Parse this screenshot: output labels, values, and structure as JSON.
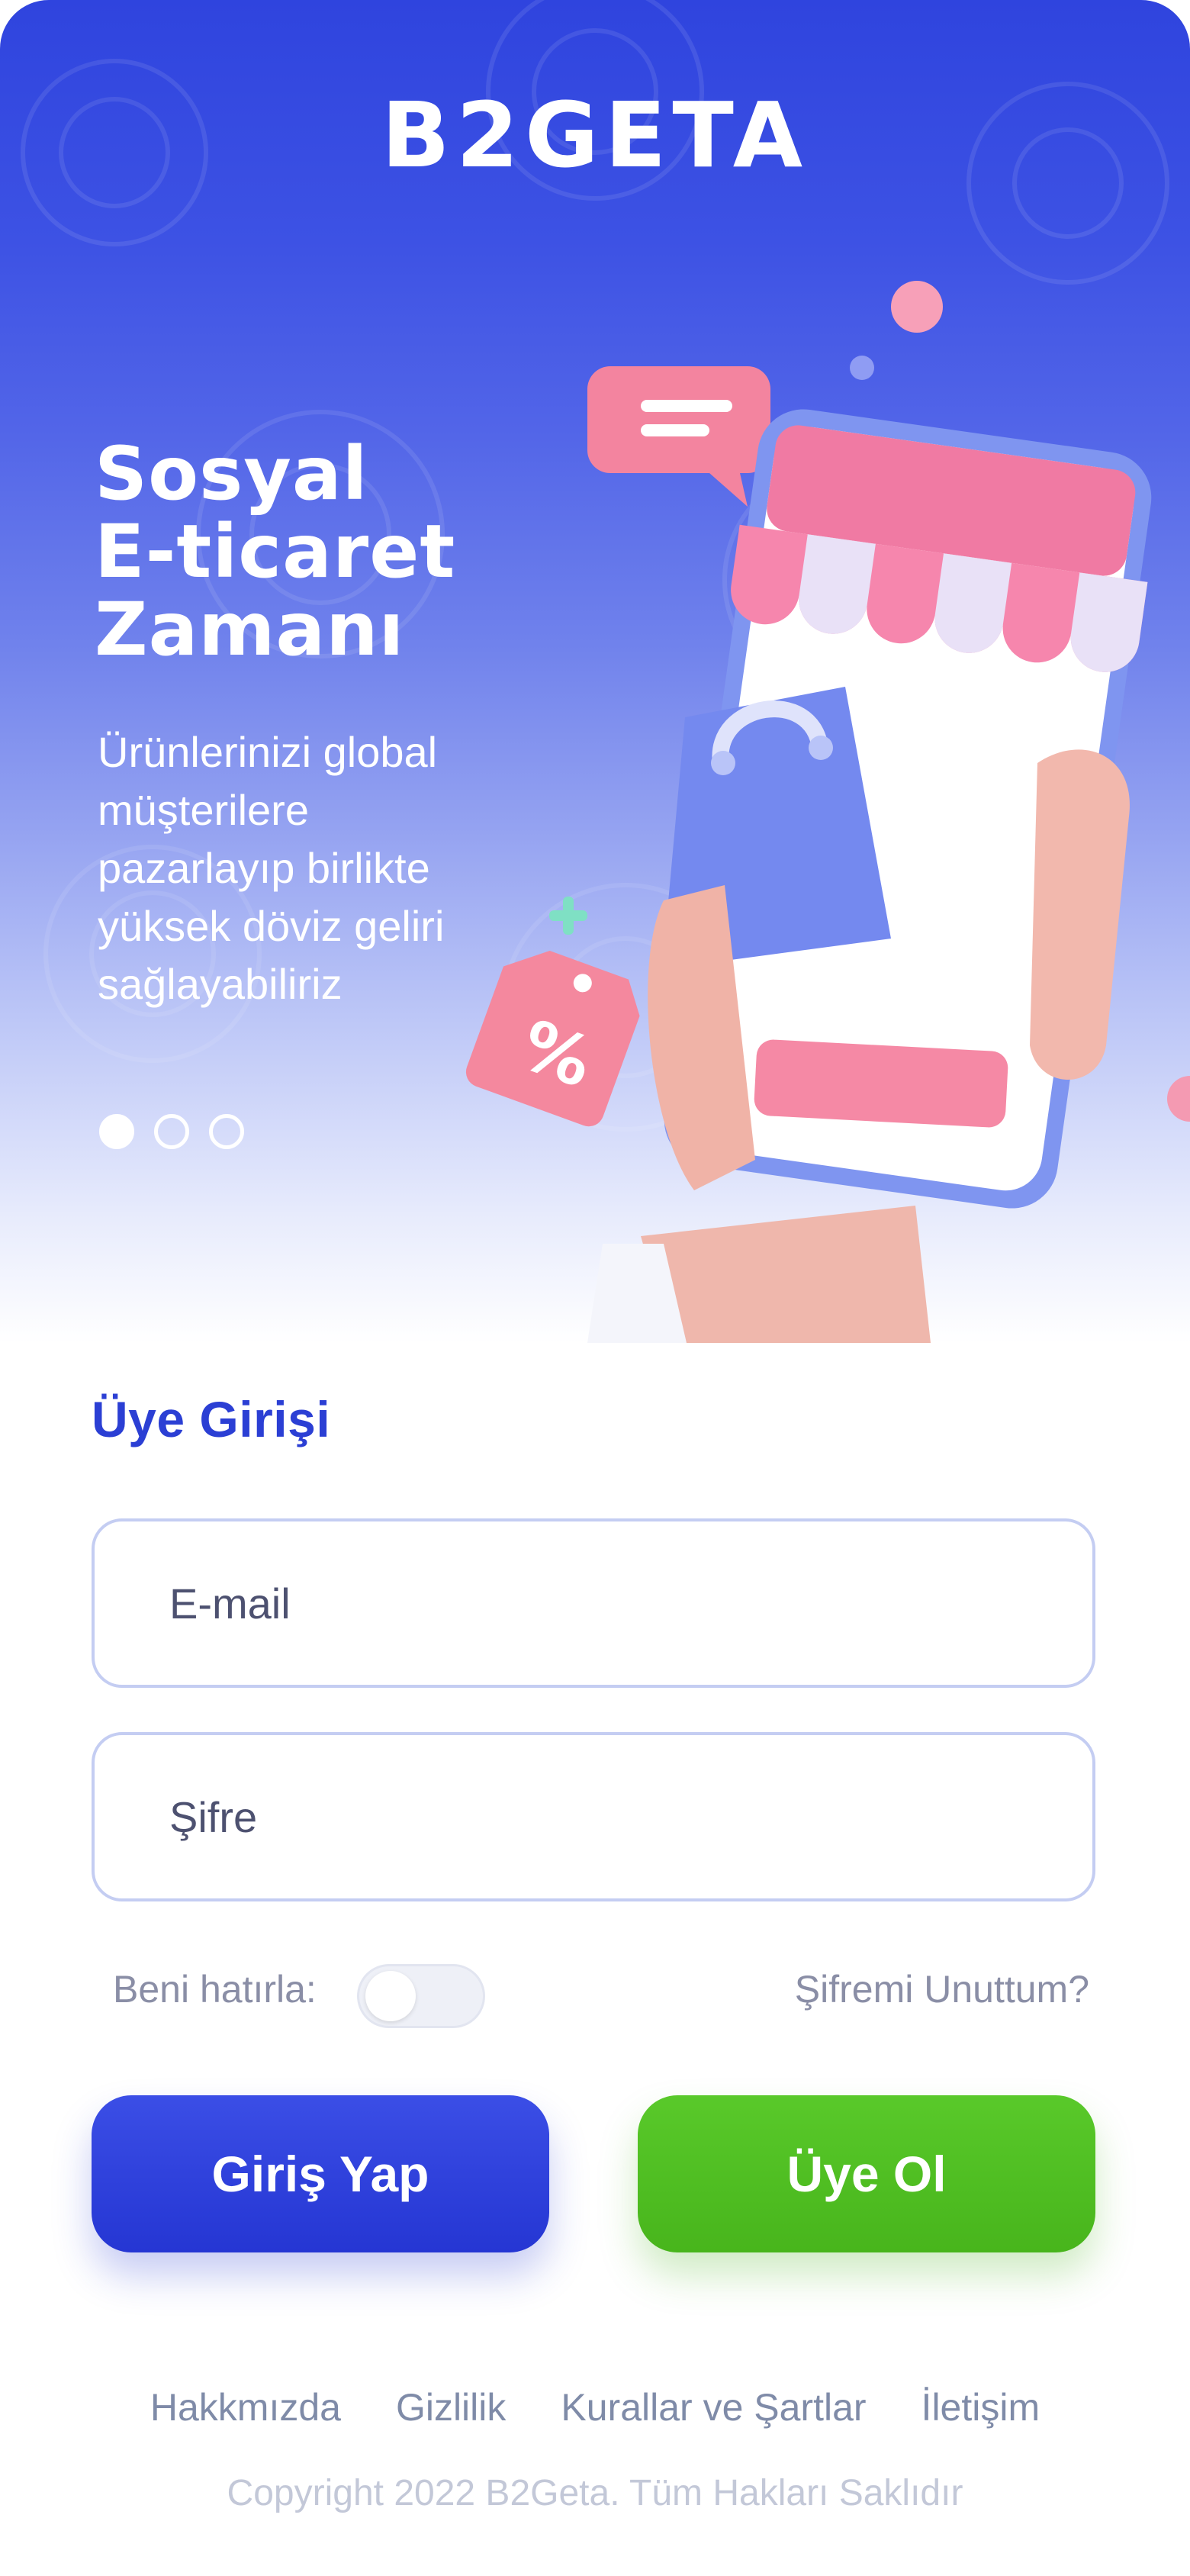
{
  "hero": {
    "logo": "B2GETA",
    "title_lines": [
      "Sosyal",
      "E-ticaret",
      "Zamanı"
    ],
    "subtitle_lines": [
      "Ürünlerinizi global",
      "müşterilere",
      "pazarlayıp birlikte",
      "yüksek döviz geliri",
      "sağlayabiliriz"
    ],
    "carousel": {
      "total": 3,
      "active": 1
    },
    "illustration_icons": [
      "hand-phone-icon",
      "shop-awning-icon",
      "shopping-bag-icon",
      "discount-tag-icon",
      "chat-bubble-icon"
    ]
  },
  "login": {
    "title": "Üye Girişi",
    "email_placeholder": "E-mail",
    "password_placeholder": "Şifre",
    "remember_label": "Beni hatırla:",
    "remember_on": false,
    "forgot_label": "Şifremi Unuttum?",
    "login_button": "Giriş Yap",
    "signup_button": "Üye Ol"
  },
  "footer": {
    "links": [
      "Hakkmızda",
      "Gizlilik",
      "Kurallar ve Şartlar",
      "İletişim"
    ],
    "copyright": "Copyright 2022 B2Geta. Tüm Hakları Saklıdır"
  },
  "colors": {
    "primary": "#2b3fd4",
    "success": "#4fbd20",
    "hero_top": "#2f44de",
    "field_border": "#c4cdf2"
  }
}
